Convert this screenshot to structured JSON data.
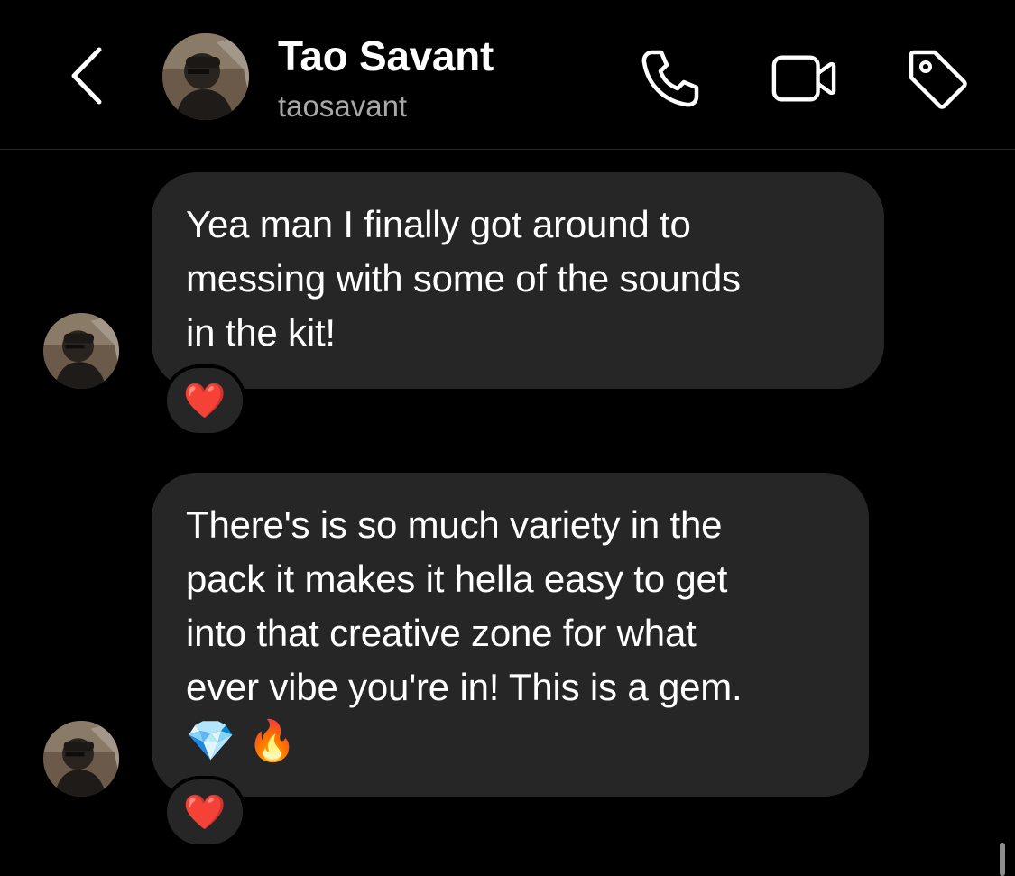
{
  "header": {
    "contact_name": "Tao Savant",
    "contact_handle": "taosavant",
    "icons": [
      "back-chevron-icon",
      "phone-icon",
      "video-camera-icon",
      "tag-icon"
    ]
  },
  "messages": [
    {
      "lines": [
        "Yea man I finally got around to",
        "messing with some of the sounds",
        "in the kit!"
      ],
      "emoji": "",
      "reaction": "❤️"
    },
    {
      "lines": [
        "There's is so much variety in the",
        "pack it makes it hella easy to get",
        "into that creative zone for what",
        "ever vibe you're in! This is a gem."
      ],
      "emoji": "💎 🔥",
      "reaction": "❤️"
    }
  ],
  "colors": {
    "background": "#000000",
    "bubble": "#262626",
    "text": "#ffffff",
    "secondary_text": "#a8a8a8",
    "heart": "#ff2d46"
  }
}
